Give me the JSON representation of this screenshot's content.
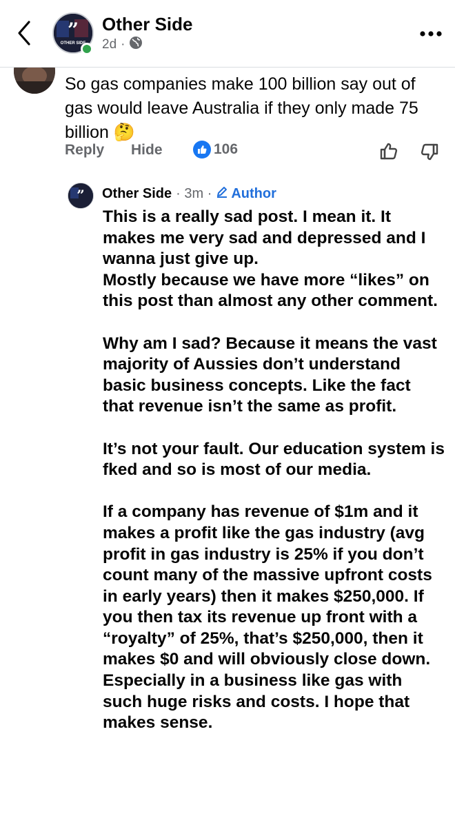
{
  "header": {
    "page_name": "Other Side",
    "post_age": "2d",
    "avatar_label": "OTHER SIDE",
    "icons": {
      "back": "chevron-left-icon",
      "privacy": "globe-icon",
      "more": "more-horizontal-icon"
    }
  },
  "comment": {
    "text": "So gas companies make 100 billion say out of gas would leave Australia if they only made 75 billion 🤔",
    "actions": {
      "reply": "Reply",
      "hide": "Hide",
      "like_count": "106"
    },
    "icons": {
      "like_badge": "thumbs-up-icon",
      "upvote": "upvote-icon",
      "downvote": "downvote-icon"
    }
  },
  "reply": {
    "author": "Other Side",
    "time": "· 3m ·",
    "author_badge": "Author",
    "paragraphs": [
      "This is a really sad post.  I mean it.  It makes me very sad and depressed and I wanna just give up.\nMostly because we have more “likes” on this post than almost any other comment.",
      "Why am I sad?  Because it means the vast majority of Aussies don’t understand basic business concepts. Like the fact that revenue isn’t the same as profit.",
      "It’s not your fault.  Our education system is fked and so is most of our media.",
      "If a company has revenue of $1m and it makes a profit like the gas industry (avg profit in gas industry is 25% if you don’t count many of the massive upfront costs in early  years)  then it makes $250,000.  If you then tax its revenue up front with a “royalty” of 25%, that’s $250,000, then it makes $0 and will obviously close down. Especially in a business like gas with such huge risks and costs.  I hope that makes sense."
    ],
    "icons": {
      "author_badge": "pencil-icon"
    }
  },
  "colors": {
    "primary_text": "#050505",
    "secondary_text": "#65676b",
    "link_blue": "#216fdb",
    "like_blue": "#1877f2",
    "online_green": "#31a24c"
  }
}
